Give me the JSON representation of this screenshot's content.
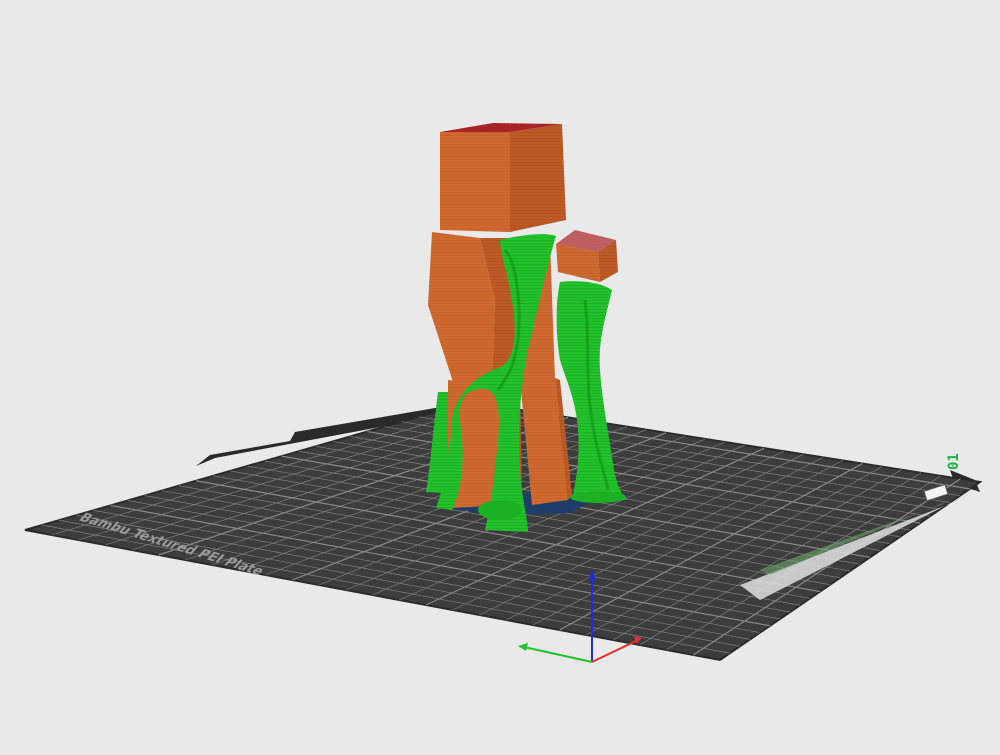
{
  "viewport": {
    "background": "#e9e9e9"
  },
  "build_plate": {
    "label": "Bambu Textured PEI Plate",
    "plate_id": "01",
    "surface_color": "#3d3d3d",
    "grid_color": "#8a8a8a",
    "edge_color": "#2a2a2a"
  },
  "model": {
    "body_color": "#d0692f",
    "body_shade": "#b95825",
    "top_face_color": "#b5282a",
    "support_color": "#22c22a",
    "support_shade": "#18961f",
    "raft_color": "#1f3d6b"
  },
  "axes": {
    "x_color": "#e03030",
    "y_color": "#22c22a",
    "z_color": "#2030d0"
  }
}
